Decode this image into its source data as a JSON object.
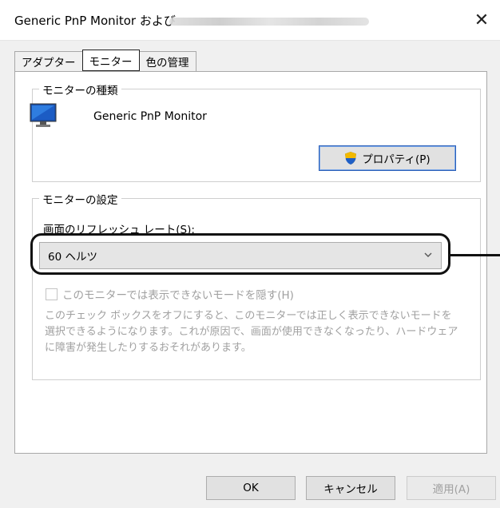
{
  "window": {
    "title": "Generic PnP Monitor および",
    "close_glyph": "✕"
  },
  "tabs": [
    {
      "label": "アダプター"
    },
    {
      "label": "モニター",
      "active": true
    },
    {
      "label": "色の管理"
    }
  ],
  "monitor_type": {
    "group_title": "モニターの種類",
    "monitor_name": "Generic PnP Monitor",
    "properties_label": "プロパティ(P)",
    "icon": "monitor-icon",
    "button_icon": "uac-shield-icon"
  },
  "monitor_settings": {
    "group_title": "モニターの設定",
    "refresh_label": "画面のリフレッシュ レート(S):",
    "refresh_value": "60 ヘルツ",
    "hide_modes_label": "このモニターでは表示できないモードを隠す(H)",
    "hide_modes_checked": false,
    "hide_modes_note": "このチェック ボックスをオフにすると、このモニターでは正しく表示できないモードを選択できるようになります。これが原因で、画面が使用できなくなったり、ハードウェアに障害が発生したりするおそれがあります。"
  },
  "footer": {
    "ok_label": "OK",
    "cancel_label": "キャンセル",
    "apply_label": "適用(A)"
  },
  "colors": {
    "dialog_bg": "#f0f0f0",
    "page_bg": "#ffffff",
    "focus_border": "#2b5fb8",
    "disabled_text": "#a0a0a0"
  }
}
